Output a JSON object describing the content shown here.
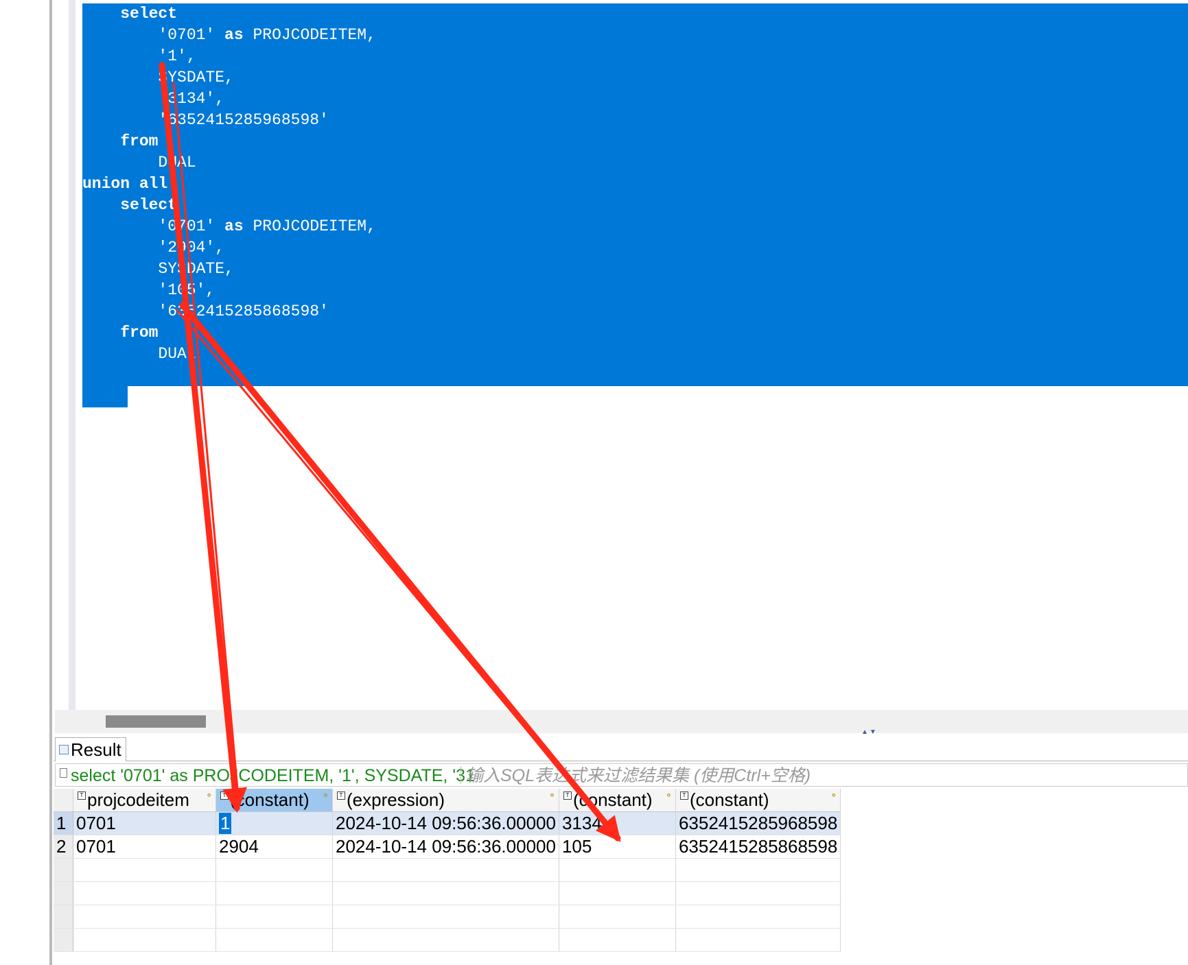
{
  "editor": {
    "lines": [
      {
        "indent": "    ",
        "parts": [
          {
            "t": "select",
            "kw": true
          }
        ]
      },
      {
        "indent": "        ",
        "parts": [
          {
            "t": "'0701' "
          },
          {
            "t": "as",
            "kw": true
          },
          {
            "t": " PROJCODEITEM,"
          }
        ]
      },
      {
        "indent": "        ",
        "parts": [
          {
            "t": "'1',"
          }
        ]
      },
      {
        "indent": "        ",
        "parts": [
          {
            "t": "SYSDATE,"
          }
        ]
      },
      {
        "indent": "        ",
        "parts": [
          {
            "t": "'3134',"
          }
        ]
      },
      {
        "indent": "        ",
        "parts": [
          {
            "t": "'6352415285968598'"
          }
        ]
      },
      {
        "indent": "    ",
        "parts": [
          {
            "t": "from",
            "kw": true
          }
        ]
      },
      {
        "indent": "        ",
        "parts": [
          {
            "t": "DUAL"
          }
        ]
      },
      {
        "indent": "",
        "parts": [
          {
            "t": "union all",
            "kw": true
          }
        ]
      },
      {
        "indent": "    ",
        "parts": [
          {
            "t": "select",
            "kw": true
          }
        ]
      },
      {
        "indent": "        ",
        "parts": [
          {
            "t": "'0701' "
          },
          {
            "t": "as",
            "kw": true
          },
          {
            "t": " PROJCODEITEM,"
          }
        ]
      },
      {
        "indent": "        ",
        "parts": [
          {
            "t": "'2904',"
          }
        ]
      },
      {
        "indent": "        ",
        "parts": [
          {
            "t": "SYSDATE,"
          }
        ]
      },
      {
        "indent": "        ",
        "parts": [
          {
            "t": "'105',"
          }
        ]
      },
      {
        "indent": "        ",
        "parts": [
          {
            "t": "'6352415285868598'"
          }
        ]
      },
      {
        "indent": "    ",
        "parts": [
          {
            "t": "from",
            "kw": true
          }
        ]
      },
      {
        "indent": "        ",
        "parts": [
          {
            "t": "DUAL"
          }
        ]
      }
    ],
    "selection_color": "#0078d7"
  },
  "result_panel": {
    "tab_label": "Result",
    "tab_icon": "grid-icon",
    "filter_query": "select '0701' as PROJCODEITEM, '1', SYSDATE, '31",
    "filter_placeholder": "输入SQL表达式来过滤结果集 (使用Ctrl+空格)",
    "columns": [
      {
        "label": "projcodeitem",
        "type_icon": "text-type-icon"
      },
      {
        "label": "(constant)",
        "type_icon": "text-type-icon",
        "selected": true
      },
      {
        "label": "(expression)",
        "type_icon": "expression-type-icon"
      },
      {
        "label": "(constant)",
        "type_icon": "text-type-icon"
      },
      {
        "label": "(constant)",
        "type_icon": "text-type-icon"
      }
    ],
    "rows": [
      {
        "num": "1",
        "cells": [
          "0701",
          "1",
          "2024-10-14 09:56:36.00000",
          "3134",
          "6352415285968598"
        ]
      },
      {
        "num": "2",
        "cells": [
          "0701",
          "2904",
          "2024-10-14 09:56:36.00000",
          "105",
          "6352415285868598"
        ]
      }
    ],
    "selected_row": 0,
    "selected_cell": [
      0,
      1
    ]
  },
  "annotation_color": "#ff2a1a"
}
